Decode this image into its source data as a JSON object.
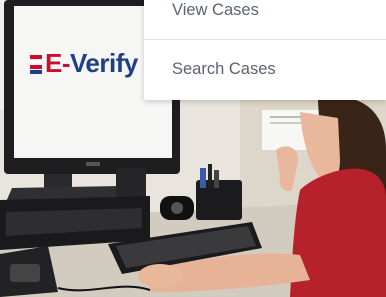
{
  "menu": {
    "items": [
      {
        "label": "View Cases"
      },
      {
        "label": "Search Cases"
      }
    ]
  },
  "logo": {
    "text_e": "E",
    "text_dash": "-",
    "text_verify": "Verify"
  },
  "colors": {
    "logo_red": "#c8102e",
    "logo_blue": "#1f3f88",
    "menu_text": "#5a6470"
  }
}
